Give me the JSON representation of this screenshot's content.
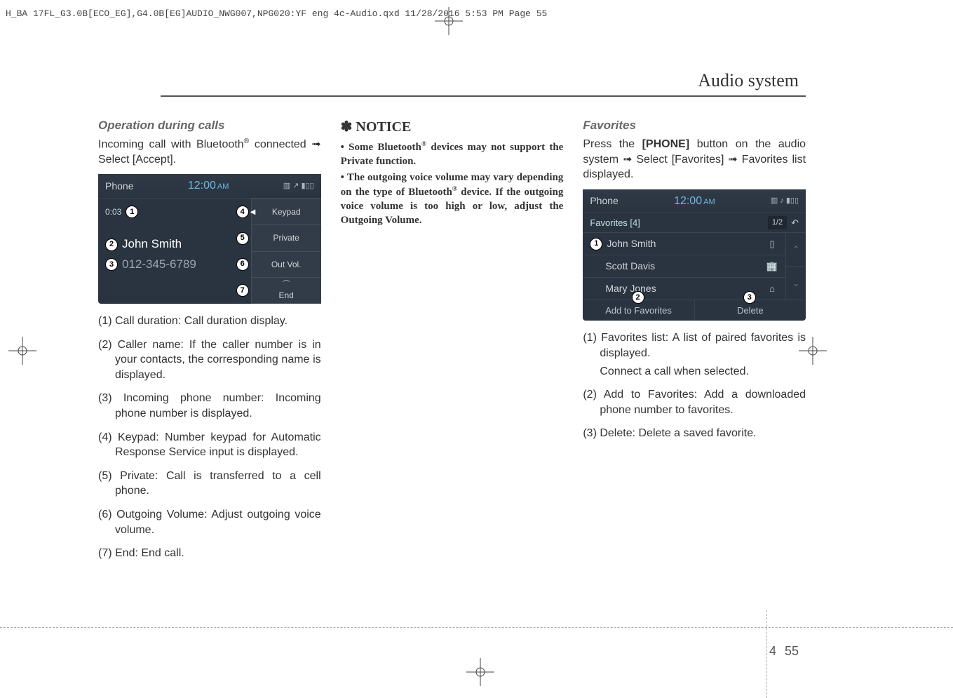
{
  "header_line": "H_BA 17FL_G3.0B[ECO_EG],G4.0B[EG]AUDIO_NWG007,NPG020:YF eng 4c-Audio.qxd  11/28/2016  5:53 PM  Page 55",
  "section_title": "Audio system",
  "col1": {
    "heading": "Operation during calls",
    "intro_a": "Incoming call with Bluetooth",
    "intro_b": " connected ➟ Select [Accept].",
    "screenshot": {
      "app": "Phone",
      "time": "12:00",
      "ampm": "AM",
      "status_icons": "▥ ↗ ▮▯▯",
      "duration": "0:03",
      "caller_name": "John Smith",
      "phone_number": "012-345-6789",
      "buttons": {
        "keypad": "Keypad",
        "private": "Private",
        "outvol": "Out Vol.",
        "end": "End"
      },
      "markers": {
        "m1": "1",
        "m2": "2",
        "m3": "3",
        "m4": "4",
        "m5": "5",
        "m6": "6",
        "m7": "7"
      }
    },
    "items": {
      "i1": "(1) Call duration: Call duration display.",
      "i2": "(2) Caller name: If the caller number is in your contacts, the corresponding name is displayed.",
      "i3": "(3) Incoming phone number: Incoming phone number is displayed.",
      "i4": "(4) Keypad: Number keypad for Automatic Response Service input is displayed.",
      "i5": "(5) Private: Call is transferred to a cell phone.",
      "i6": "(6) Outgoing Volume: Adjust outgoing voice volume.",
      "i7": "(7) End: End call."
    }
  },
  "col2": {
    "notice_head": "✽ NOTICE",
    "bullet1_a": "• Some Bluetooth",
    "bullet1_b": " devices may not support the Private function.",
    "bullet2_a": "• The outgoing voice volume may vary depending on the type of Bluetooth",
    "bullet2_b": " device. If the outgoing voice volume is too high or low, adjust the Outgoing Volume."
  },
  "col3": {
    "heading": "Favorites",
    "intro_a": "Press the ",
    "intro_btn": "[PHONE]",
    "intro_b": " button on the audio system ➟ Select [Favorites] ➟ Favorites list displayed.",
    "screenshot": {
      "app": "Phone",
      "time": "12:00",
      "ampm": "AM",
      "status_icons": "▥ ♪ ▮▯▯",
      "fav_title": "Favorites [4]",
      "page": "1/2",
      "rows": {
        "r1": "John Smith",
        "r2": "Scott Davis",
        "r3": "Mary Jones"
      },
      "icons": {
        "i1": "▯",
        "i2": "🏢",
        "i3": "⌂"
      },
      "footer": {
        "add": "Add to Favorites",
        "delete": "Delete"
      },
      "markers": {
        "m1": "1",
        "m2": "2",
        "m3": "3"
      }
    },
    "items": {
      "i1a": "(1) Favorites list: A list of paired favorites is displayed.",
      "i1b": "Connect a call when selected.",
      "i2": "(2) Add to Favorites: Add a downloaded phone number to favorites.",
      "i3": "(3) Delete: Delete a saved favorite."
    }
  },
  "page": {
    "chapter": "4",
    "num": "55"
  }
}
